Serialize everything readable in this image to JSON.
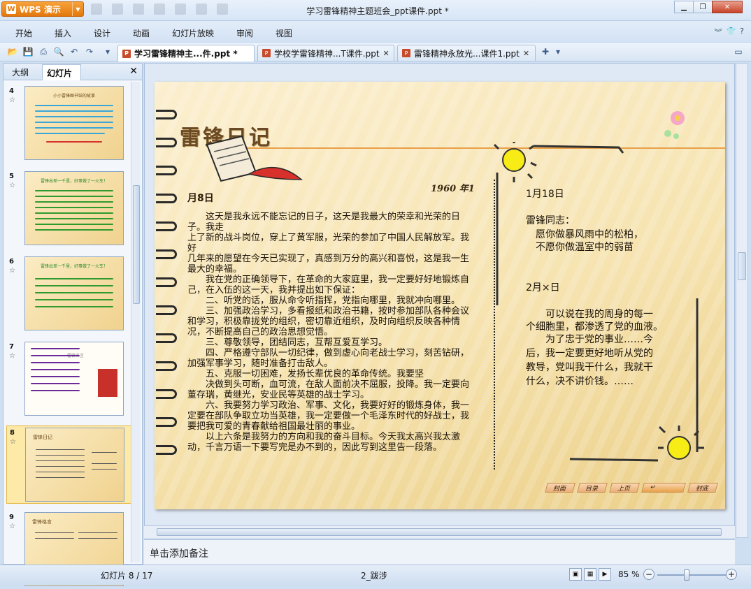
{
  "app": {
    "name": "WPS 演示",
    "window_title": "学习雷锋精神主题班会_ppt课件.ppt *"
  },
  "menu": [
    "开始",
    "插入",
    "设计",
    "动画",
    "幻灯片放映",
    "审阅",
    "视图"
  ],
  "tabs": [
    {
      "label": "学习雷锋精神主...件.ppt *",
      "active": true
    },
    {
      "label": "学校学雷锋精神...T课件.ppt",
      "active": false
    },
    {
      "label": "雷锋精神永放光...课件1.ppt",
      "active": false
    }
  ],
  "left_panel": {
    "tab_outline": "大纲",
    "tab_slides": "幻灯片",
    "thumbnails": [
      {
        "num": "4",
        "title": "小小雷锋图书馆的故事"
      },
      {
        "num": "5",
        "title": "雷锋出差一千里，好事做了一火车！"
      },
      {
        "num": "6",
        "title": "雷锋出差一千里，好事做了一火车！"
      },
      {
        "num": "7",
        "title": "雷锋名言"
      },
      {
        "num": "8",
        "title": "雷锋日记",
        "selected": true
      },
      {
        "num": "9",
        "title": "雷锋格言"
      }
    ]
  },
  "slide": {
    "title": "雷锋日记",
    "year": "1960 年1",
    "left_date": "月8日",
    "body": [
      "　　这天是我永远不能忘记的日子，这天是我最大的荣幸和光荣的日子。我走",
      "上了新的战斗岗位，穿上了黄军服，光荣的参加了中国人民解放军。我好",
      "几年来的愿望在今天已实现了，真感到万分的高兴和喜悦，这是我一生最大的幸福。",
      "　　我在党的正确领导下，在革命的大家庭里，我一定要好好地锻炼自己，在入伍的这一天，我并提出如下保证：",
      "　　二、听党的话，服从命令听指挥，党指向哪里，我就冲向哪里。",
      "　　三、加强政治学习，多看报纸和政治书籍，按时参加部队各种会议和学习，积极靠拢党的组织，密切靠近组织，及时向组织反映各种情况，不断提高自己的政治思想觉悟。",
      "　　三、尊敬领导，团结同志，互帮互爱互学习。",
      "　　四、严格遵守部队一切纪律，做到虚心向老战士学习，刻苦钻研，加强军事学习，随时准备打击敌人。",
      "　　五、克服一切困难，发扬长辈优良的革命传统。我要坚",
      "　　决做到头可断，血可流，在敌人面前决不屈服，投降。我一定要向董存瑞，黄继光，安业民等英雄的战士学习。",
      "　　六、我要努力学习政治、军事、文化，我要好好的锻炼身体，我一定要在部队争取立功当英雄，我一定要做一个毛泽东时代的好战士，我要把我可爱的青春献给祖国最壮丽的事业。",
      "　　以上六条是我努力的方向和我的奋斗目标。今天我太高兴我太激动，千言万语一下要写完是办不到的，因此写到这里告一段落。"
    ],
    "right_date1": "1月18日",
    "right_greet": "雷锋同志：",
    "right_line1": "　愿你做暴风雨中的松柏，",
    "right_line2": "　不愿你做温室中的弱苗",
    "right_date2": "2月×日",
    "right_p2": [
      "　　可以说在我的周身的每一",
      "个细胞里，都渗透了党的血液。",
      "　　为了忠于党的事业……今",
      "后，我一定要更好地听从党的",
      "教导，党叫我干什么，我就干",
      "什么，决不讲价钱。……"
    ],
    "nav": [
      "封面",
      "目录",
      "上页",
      "",
      "封底"
    ]
  },
  "notes_placeholder": "单击添加备注",
  "status": {
    "slide_info": "幻灯片 8 / 17",
    "theme": "2_跋涉",
    "zoom": "85 %"
  },
  "zoom_level": 0.42
}
